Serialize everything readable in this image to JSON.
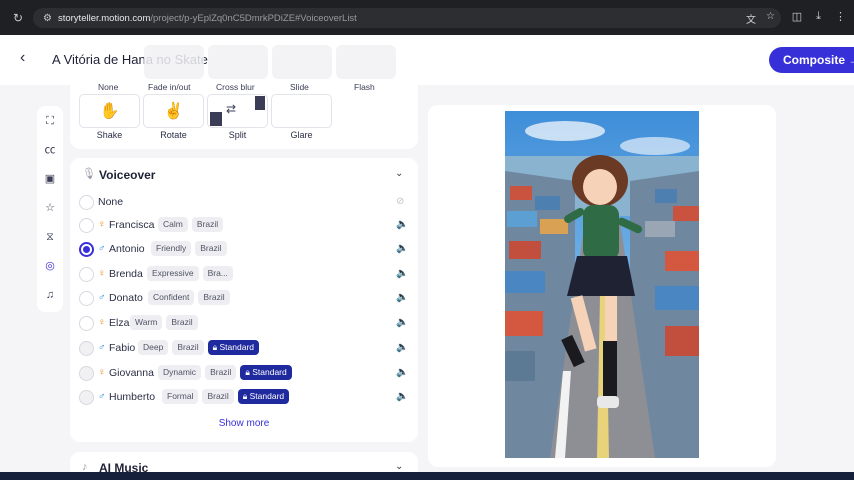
{
  "browser": {
    "url_domain": "storyteller.motion.com",
    "url_path": "/project/p-yEplZq0nC5DmrkPDiZE#VoiceoverList"
  },
  "header": {
    "title": "A Vitória de Hana no Skate",
    "composite_label": "Composite"
  },
  "transitions": {
    "top_labels": [
      "None",
      "Fade in/out",
      "Cross blur",
      "Slide",
      "Flash"
    ],
    "tiles": [
      {
        "label": "Shake",
        "icon": "shake-icon"
      },
      {
        "label": "Rotate",
        "icon": "rotate-icon"
      },
      {
        "label": "Split",
        "icon": "split-icon"
      },
      {
        "label": "Glare",
        "icon": "glare-icon"
      }
    ]
  },
  "rail": [
    "text-frame-icon",
    "captions-icon",
    "image-icon",
    "sparkle-icon",
    "transition-icon",
    "microphone-icon",
    "music-icon"
  ],
  "voiceover": {
    "title": "Voiceover",
    "none_label": "None",
    "voices": [
      {
        "name": "Francisca",
        "gender": "female",
        "tags": [
          "Calm",
          "Brazil"
        ],
        "standard": false,
        "selected": false
      },
      {
        "name": "Antonio",
        "gender": "male",
        "tags": [
          "Friendly",
          "Brazil"
        ],
        "standard": false,
        "selected": true
      },
      {
        "name": "Brenda",
        "gender": "female",
        "tags": [
          "Expressive",
          "Bra..."
        ],
        "standard": false,
        "selected": false
      },
      {
        "name": "Donato",
        "gender": "male",
        "tags": [
          "Confident",
          "Brazil"
        ],
        "standard": false,
        "selected": false
      },
      {
        "name": "Elza",
        "gender": "female",
        "tags": [
          "Warm",
          "Brazil"
        ],
        "standard": false,
        "selected": false
      },
      {
        "name": "Fabio",
        "gender": "male",
        "tags": [
          "Deep",
          "Brazil"
        ],
        "standard": true,
        "selected": false
      },
      {
        "name": "Giovanna",
        "gender": "female",
        "tags": [
          "Dynamic",
          "Brazil"
        ],
        "standard": true,
        "selected": false
      },
      {
        "name": "Humberto",
        "gender": "male",
        "tags": [
          "Formal",
          "Brazil"
        ],
        "standard": true,
        "selected": false
      }
    ],
    "standard_label": "Standard",
    "show_more": "Show more"
  },
  "music": {
    "title": "AI Music"
  },
  "colors": {
    "accent": "#3730d9",
    "standard_badge": "#1f2a9e",
    "female": "#e8860c",
    "male": "#2a8fd6"
  }
}
